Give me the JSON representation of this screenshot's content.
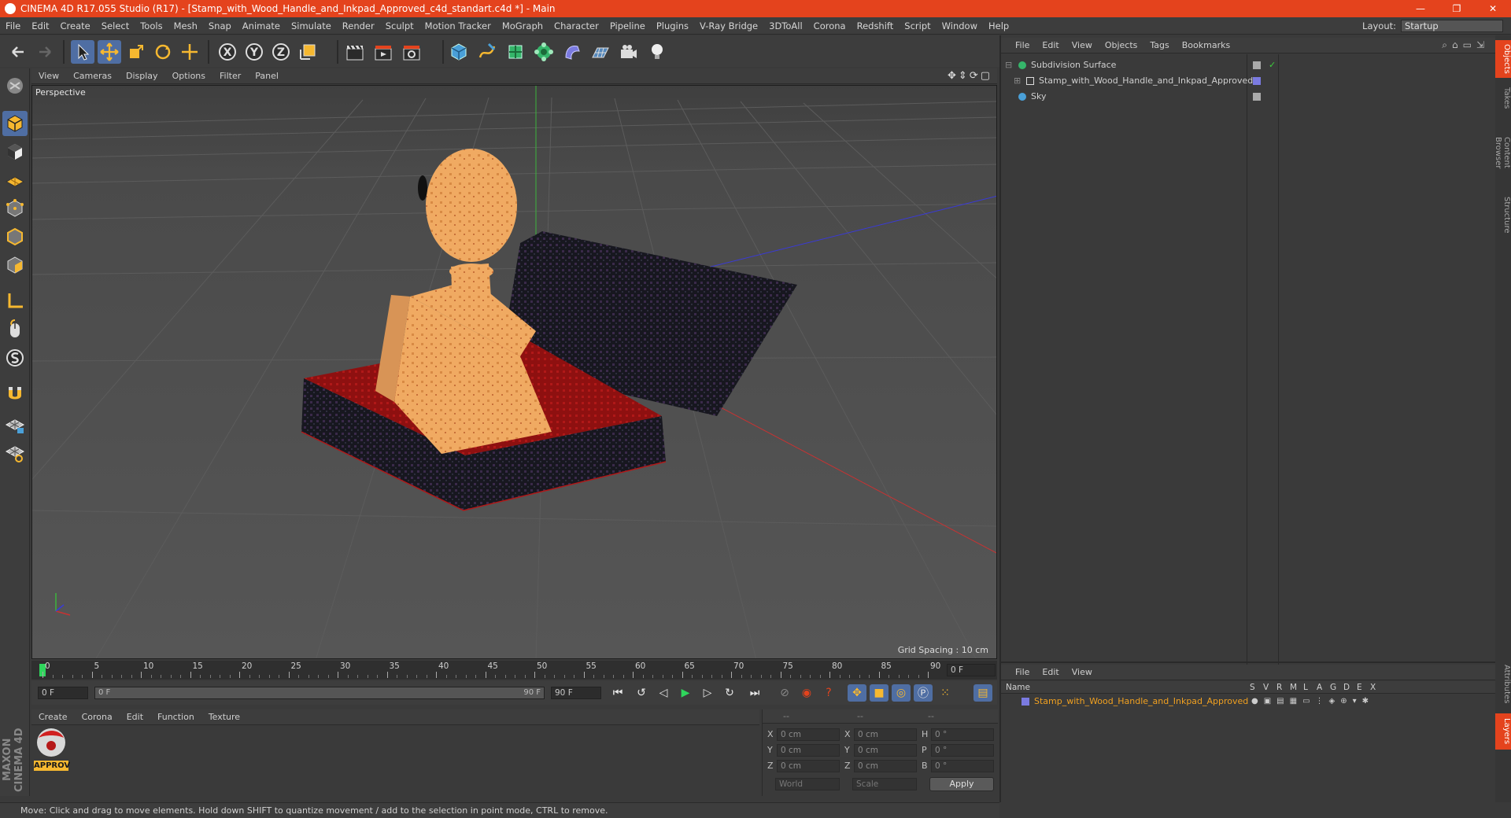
{
  "window": {
    "title": "CINEMA 4D R17.055 Studio (R17) - [Stamp_with_Wood_Handle_and_Inkpad_Approved_c4d_standart.c4d *] - Main",
    "minimize": "—",
    "maximize": "❐",
    "close": "✕"
  },
  "menubar": [
    "File",
    "Edit",
    "Create",
    "Select",
    "Tools",
    "Mesh",
    "Snap",
    "Animate",
    "Simulate",
    "Render",
    "Sculpt",
    "Motion Tracker",
    "MoGraph",
    "Character",
    "Pipeline",
    "Plugins",
    "V-Ray Bridge",
    "3DToAll",
    "Corona",
    "Redshift",
    "Script",
    "Window",
    "Help"
  ],
  "layout": {
    "label": "Layout:",
    "value": "Startup"
  },
  "toolbar": {
    "x_label": "X",
    "y_label": "Y",
    "z_label": "Z"
  },
  "viewport": {
    "menu": [
      "View",
      "Cameras",
      "Display",
      "Options",
      "Filter",
      "Panel"
    ],
    "camera_label": "Perspective",
    "grid_spacing": "Grid Spacing : 10 cm"
  },
  "timeline": {
    "ticks": [
      "0",
      "5",
      "10",
      "15",
      "20",
      "25",
      "30",
      "35",
      "40",
      "45",
      "50",
      "55",
      "60",
      "65",
      "70",
      "75",
      "80",
      "85",
      "90"
    ],
    "current_frame": "0 F",
    "start_field": "0 F",
    "range_start": "0 F",
    "range_end": "90 F",
    "end_field": "90 F"
  },
  "material_manager": {
    "menu": [
      "Create",
      "Corona",
      "Edit",
      "Function",
      "Texture"
    ],
    "materials": [
      {
        "name": "APPROV"
      }
    ]
  },
  "coordinates": {
    "headers": [
      "--",
      "--",
      "--"
    ],
    "rows": [
      {
        "a": "X",
        "av": "0 cm",
        "b": "X",
        "bv": "0 cm",
        "c": "H",
        "cv": "0 °"
      },
      {
        "a": "Y",
        "av": "0 cm",
        "b": "Y",
        "bv": "0 cm",
        "c": "P",
        "cv": "0 °"
      },
      {
        "a": "Z",
        "av": "0 cm",
        "b": "Z",
        "bv": "0 cm",
        "c": "B",
        "cv": "0 °"
      }
    ],
    "mode1": "World",
    "mode2": "Scale",
    "apply": "Apply"
  },
  "status": "Move: Click and drag to move elements. Hold down SHIFT to quantize movement / add to the selection in point mode, CTRL to remove.",
  "brand": "MAXON CINEMA 4D",
  "object_manager": {
    "menu": [
      "File",
      "Edit",
      "View",
      "Objects",
      "Tags",
      "Bookmarks"
    ],
    "objects": [
      {
        "name": "Subdivision Surface"
      },
      {
        "name": "Stamp_with_Wood_Handle_and_Inkpad_Approved"
      },
      {
        "name": "Sky"
      }
    ]
  },
  "layer_manager": {
    "menu": [
      "File",
      "Edit",
      "View"
    ],
    "columns": {
      "name": "Name",
      "flags": [
        "S",
        "V",
        "R",
        "M",
        "L",
        "A",
        "G",
        "D",
        "E",
        "X"
      ]
    },
    "layers": [
      {
        "name": "Stamp_with_Wood_Handle_and_Inkpad_Approved"
      }
    ]
  },
  "side_tabs": [
    "Objects",
    "Takes",
    "Content Browser",
    "Structure",
    "Attributes",
    "Layers"
  ],
  "colors": {
    "accent": "#e4431d",
    "selected": "#4f6ea3",
    "layer_text": "#f0a020"
  }
}
